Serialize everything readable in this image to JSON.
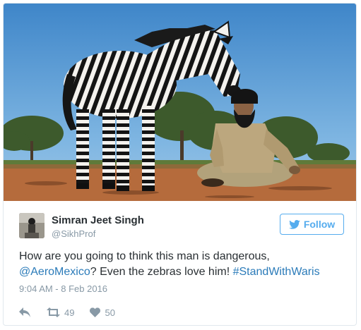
{
  "tweet": {
    "author_name": "Simran Jeet Singh",
    "author_handle": "@SikhProf",
    "follow_label": "Follow",
    "text_part1": "How are you going to think this man is dangerous, ",
    "mention": "@AeroMexico",
    "text_part2": "? Even the zebras love him! ",
    "hashtag": "#StandWithWaris",
    "timestamp": "9:04 AM - 8 Feb 2016",
    "retweets": "49",
    "likes": "50"
  },
  "icons": {
    "reply": "reply-icon",
    "retweet": "retweet-icon",
    "like": "heart-icon",
    "follow": "twitter-bird-icon"
  },
  "colors": {
    "accent": "#55acee",
    "link": "#2b7bb9",
    "meta": "#8899a6",
    "text": "#292f33"
  }
}
